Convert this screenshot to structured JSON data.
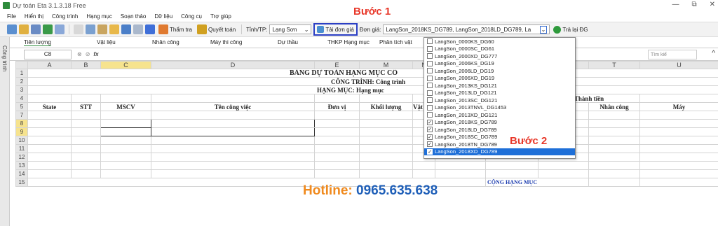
{
  "window": {
    "title": "Dự toán Eta 3.1.3.18 Free",
    "controls": [
      "—",
      "⧉",
      "✕"
    ]
  },
  "menu": [
    "File",
    "Hiển thị",
    "Công trình",
    "Hạng mục",
    "Soạn thảo",
    "Dữ liệu",
    "Công cụ",
    "Trợ giúp"
  ],
  "toolbar": {
    "tham_tra": "Thẩm tra",
    "quyet_toan": "Quyết toán",
    "tinh_label": "Tỉnh/TP:",
    "tinh_value": "Lạng Sơn",
    "tai_don_gia": "Tải đơn giá",
    "don_gia_label": "Đơn giá:",
    "don_gia_value": "LangSon_2018KS_DG789, LangSon_2018LD_DG789, La",
    "tra_lai": "Trả lại ĐG"
  },
  "annotations": {
    "step1": "Bước 1",
    "step2": "Bước 2"
  },
  "sidebar_label": "Công trình",
  "tabs": [
    "Tiên lượng",
    "Vật liệu",
    "Nhân công",
    "Máy thi công",
    "Dự thầu",
    "THKP Hạng mục",
    "Phân tích vật"
  ],
  "formula": {
    "cell": "C8",
    "search_placeholder": "Tìm kiế"
  },
  "columns": [
    "A",
    "B",
    "C",
    "D",
    "E",
    "M",
    "N",
    "",
    "",
    "R",
    "T",
    "U"
  ],
  "sheet": {
    "title": "BẢNG DỰ TOÁN HẠNG MỤC CÔ",
    "cong_trinh": "CÔNG TRÌNH: Công trình",
    "hang_muc": "HẠNG MỤC: Hạng mục",
    "thanh_tien": "Thành tiền",
    "headers": {
      "state": "State",
      "stt": "STT",
      "mscv": "MSCV",
      "ten": "Tên công việc",
      "don_vi": "Đơn vị",
      "khoi_luong": "Khối lượng",
      "vat": "Vật",
      "lieu": "liệu",
      "nhan_cong": "Nhân công",
      "may": "Máy"
    },
    "footer": "CỘNG HẠNG MỤC"
  },
  "rows": [
    "1",
    "2",
    "3",
    "4",
    "5",
    "7",
    "8",
    "9",
    "10",
    "11",
    "12",
    "13",
    "14",
    "15"
  ],
  "dropdown": [
    {
      "label": "LangSon_0000KS_DG60",
      "checked": false
    },
    {
      "label": "LangSon_0000SC_DG61",
      "checked": false
    },
    {
      "label": "LangSon_2000XD_DG777",
      "checked": false
    },
    {
      "label": "LangSon_2006KS_DG19",
      "checked": false
    },
    {
      "label": "LangSon_2006LD_DG19",
      "checked": false
    },
    {
      "label": "LangSon_2006XD_DG19",
      "checked": false
    },
    {
      "label": "LangSon_2013KS_DG121",
      "checked": false
    },
    {
      "label": "LangSon_2013LD_DG121",
      "checked": false
    },
    {
      "label": "LangSon_2013SC_DG121",
      "checked": false
    },
    {
      "label": "LangSon_2013TNVL_DG1453",
      "checked": false
    },
    {
      "label": "LangSon_2013XD_DG121",
      "checked": false
    },
    {
      "label": "LangSon_2018KS_DG789",
      "checked": true
    },
    {
      "label": "LangSon_2018LD_DG789",
      "checked": true
    },
    {
      "label": "LangSon_2018SC_DG789",
      "checked": true
    },
    {
      "label": "LangSon_2018TN_DG789",
      "checked": true
    },
    {
      "label": "LangSon_2018XD_DG789",
      "checked": true,
      "selected": true
    }
  ],
  "hotline": {
    "label": "Hotline:",
    "number": "0965.635.638"
  },
  "colors": {
    "accent_red": "#e8382a",
    "selection_blue": "#1e6fd8",
    "hotline_orange": "#f08a1e",
    "hotline_blue": "#1f5fb8"
  }
}
